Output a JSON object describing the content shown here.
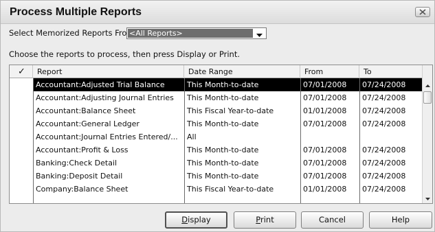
{
  "window": {
    "title": "Process Multiple Reports",
    "close_icon": "close-icon"
  },
  "select": {
    "label": "Select Memorized Reports From",
    "value": "<All Reports>"
  },
  "instructions": "Choose the reports to process, then press Display or Print.",
  "table": {
    "columns": {
      "check": "✓",
      "report": "Report",
      "date_range": "Date Range",
      "from": "From",
      "to": "To"
    },
    "rows": [
      {
        "report": "Accountant:Adjusted Trial Balance",
        "date_range": "This Month-to-date",
        "from": "07/01/2008",
        "to": "07/24/2008",
        "selected": true
      },
      {
        "report": "Accountant:Adjusting Journal Entries",
        "date_range": "This Month-to-date",
        "from": "07/01/2008",
        "to": "07/24/2008"
      },
      {
        "report": "Accountant:Balance Sheet",
        "date_range": "This Fiscal Year-to-date",
        "from": "01/01/2008",
        "to": "07/24/2008"
      },
      {
        "report": "Accountant:General Ledger",
        "date_range": "This Month-to-date",
        "from": "07/01/2008",
        "to": "07/24/2008"
      },
      {
        "report": "Accountant:Journal Entries Entered/...",
        "date_range": "All",
        "from": "",
        "to": ""
      },
      {
        "report": "Accountant:Profit & Loss",
        "date_range": "This Month-to-date",
        "from": "07/01/2008",
        "to": "07/24/2008"
      },
      {
        "report": "Banking:Check Detail",
        "date_range": "This Month-to-date",
        "from": "07/01/2008",
        "to": "07/24/2008"
      },
      {
        "report": "Banking:Deposit Detail",
        "date_range": "This Month-to-date",
        "from": "07/01/2008",
        "to": "07/24/2008"
      },
      {
        "report": "Company:Balance Sheet",
        "date_range": "This Fiscal Year-to-date",
        "from": "01/01/2008",
        "to": "07/24/2008"
      }
    ]
  },
  "buttons": {
    "display": "Display",
    "print": "Print",
    "cancel": "Cancel",
    "help": "Help"
  },
  "colors": {
    "selected_row_bg": "#000000",
    "selected_row_text": "#ffffff",
    "combo_highlight": "#6d6d6d"
  }
}
